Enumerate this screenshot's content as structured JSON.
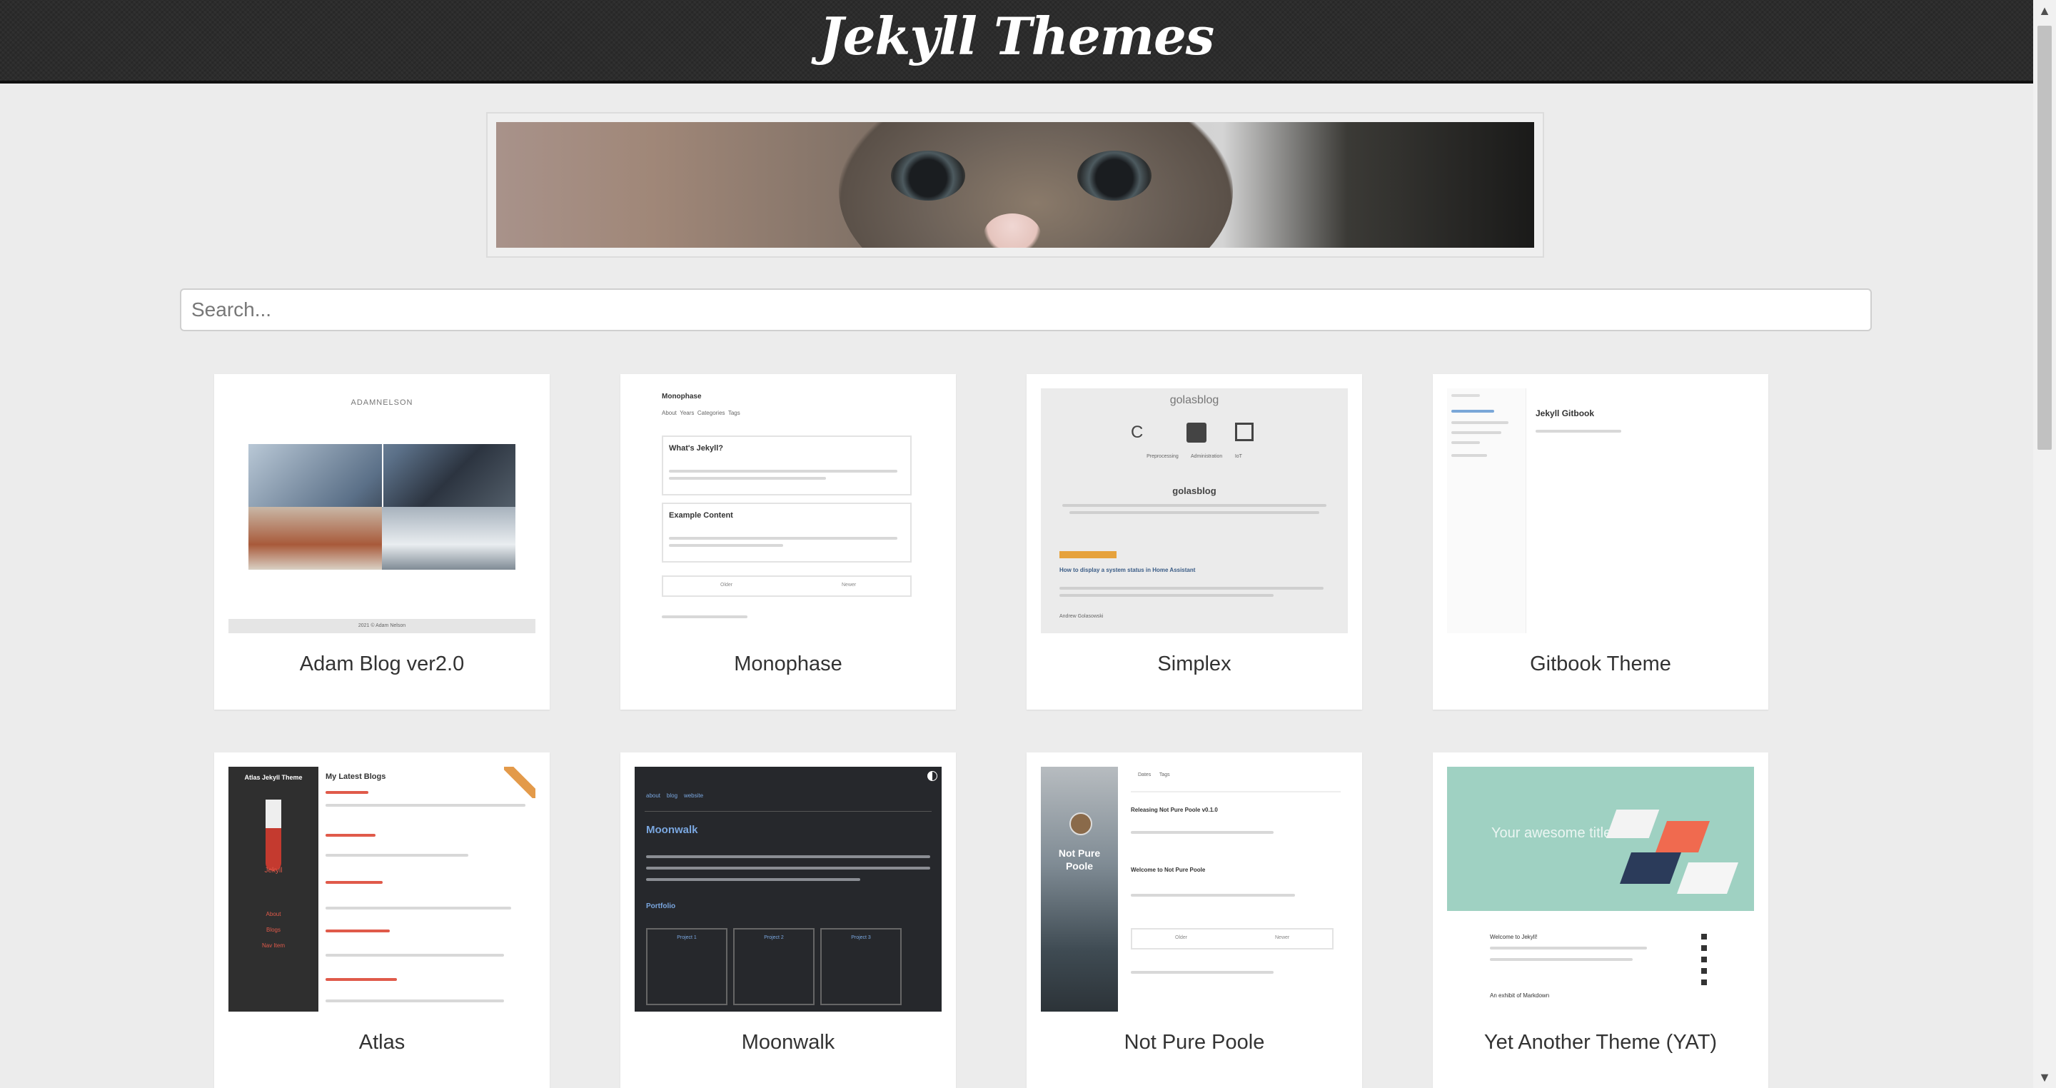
{
  "header": {
    "title": "Jekyll Themes"
  },
  "search": {
    "placeholder": "Search..."
  },
  "themes": [
    {
      "title": "Adam Blog ver2.0",
      "thumb_text": [
        "ADAMNELSON",
        "2021 © Adam Nelson"
      ]
    },
    {
      "title": "Monophase",
      "thumb_text": [
        "Monophase",
        "About",
        "Years",
        "Categories",
        "Tags",
        "What's Jekyll?",
        "Example Content",
        "Older",
        "Newer"
      ]
    },
    {
      "title": "Simplex",
      "thumb_text": [
        "golasblog",
        "Preprocessing",
        "Administration",
        "IoT",
        "How to display a system status in Home Assistant",
        "Andrew Golasowski"
      ]
    },
    {
      "title": "Gitbook Theme",
      "thumb_text": [
        "Jekyll Gitbook"
      ]
    },
    {
      "title": "Atlas",
      "thumb_text": [
        "Atlas Jekyll Theme",
        "My Latest Blogs",
        "Jekyll",
        "About",
        "Blogs",
        "Nav Item"
      ]
    },
    {
      "title": "Moonwalk",
      "thumb_text": [
        "about",
        "blog",
        "website",
        "Moonwalk",
        "Portfolio",
        "Project 1",
        "Project 2",
        "Project 3"
      ]
    },
    {
      "title": "Not Pure Poole",
      "thumb_text": [
        "Not Pure Poole",
        "Dates",
        "Tags",
        "Releasing Not Pure Poole v0.1.0",
        "Welcome to Not Pure Poole",
        "Older",
        "Newer"
      ]
    },
    {
      "title": "Yet Another Theme (YAT)",
      "thumb_text": [
        "Your awesome title",
        "Welcome to Jekyll!",
        "An exhibit of Markdown"
      ]
    }
  ],
  "colors": {
    "header_bg": "#2c2c2c",
    "page_bg": "#ececec",
    "card_bg": "#ffffff",
    "moonwalk_accent": "#7aa7e0",
    "atlas_accent": "#e05a4a",
    "yat_bg": "#9fd1c2"
  }
}
